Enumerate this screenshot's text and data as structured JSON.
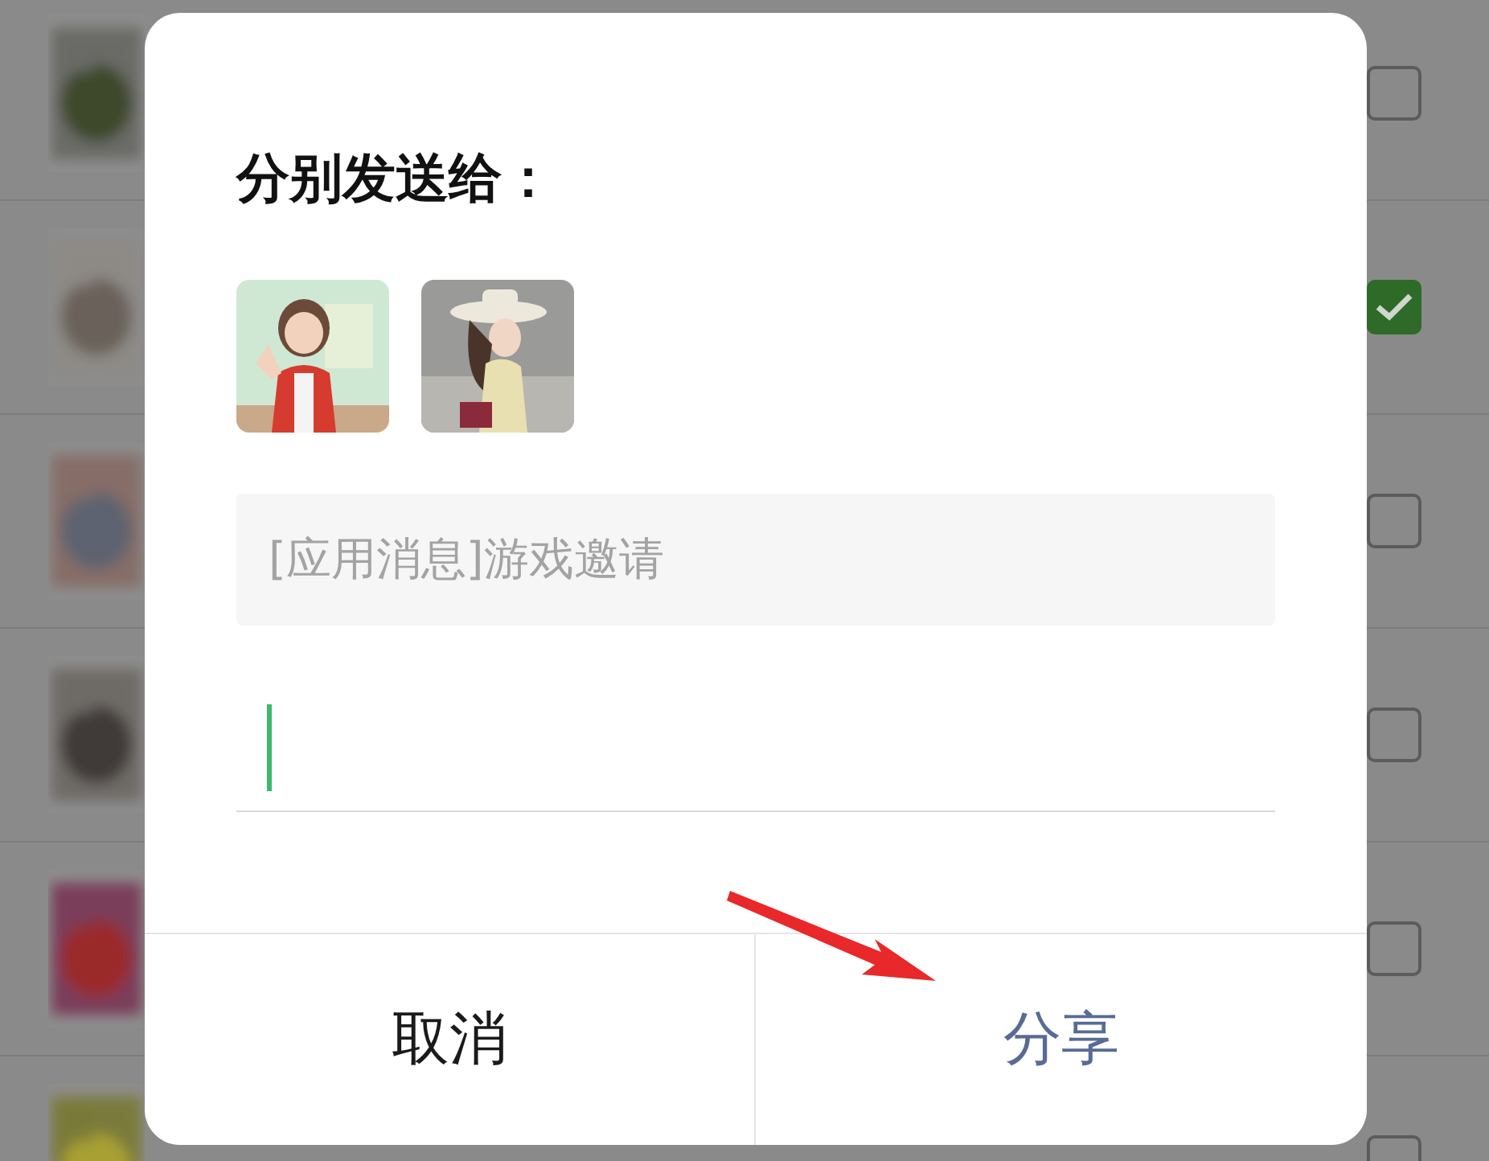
{
  "background_list": {
    "rows": [
      {
        "checked": false
      },
      {
        "checked": true
      },
      {
        "checked": false
      },
      {
        "checked": false
      },
      {
        "checked": false
      },
      {
        "checked": false
      }
    ]
  },
  "dialog": {
    "title": "分别发送给：",
    "message": "[应用消息]游戏邀请",
    "input": {
      "focused": true
    },
    "buttons": [
      {
        "label": "取消",
        "kind": "cancel"
      },
      {
        "label": "分享",
        "kind": "primary"
      }
    ]
  },
  "annotation": {
    "kind": "arrow"
  }
}
